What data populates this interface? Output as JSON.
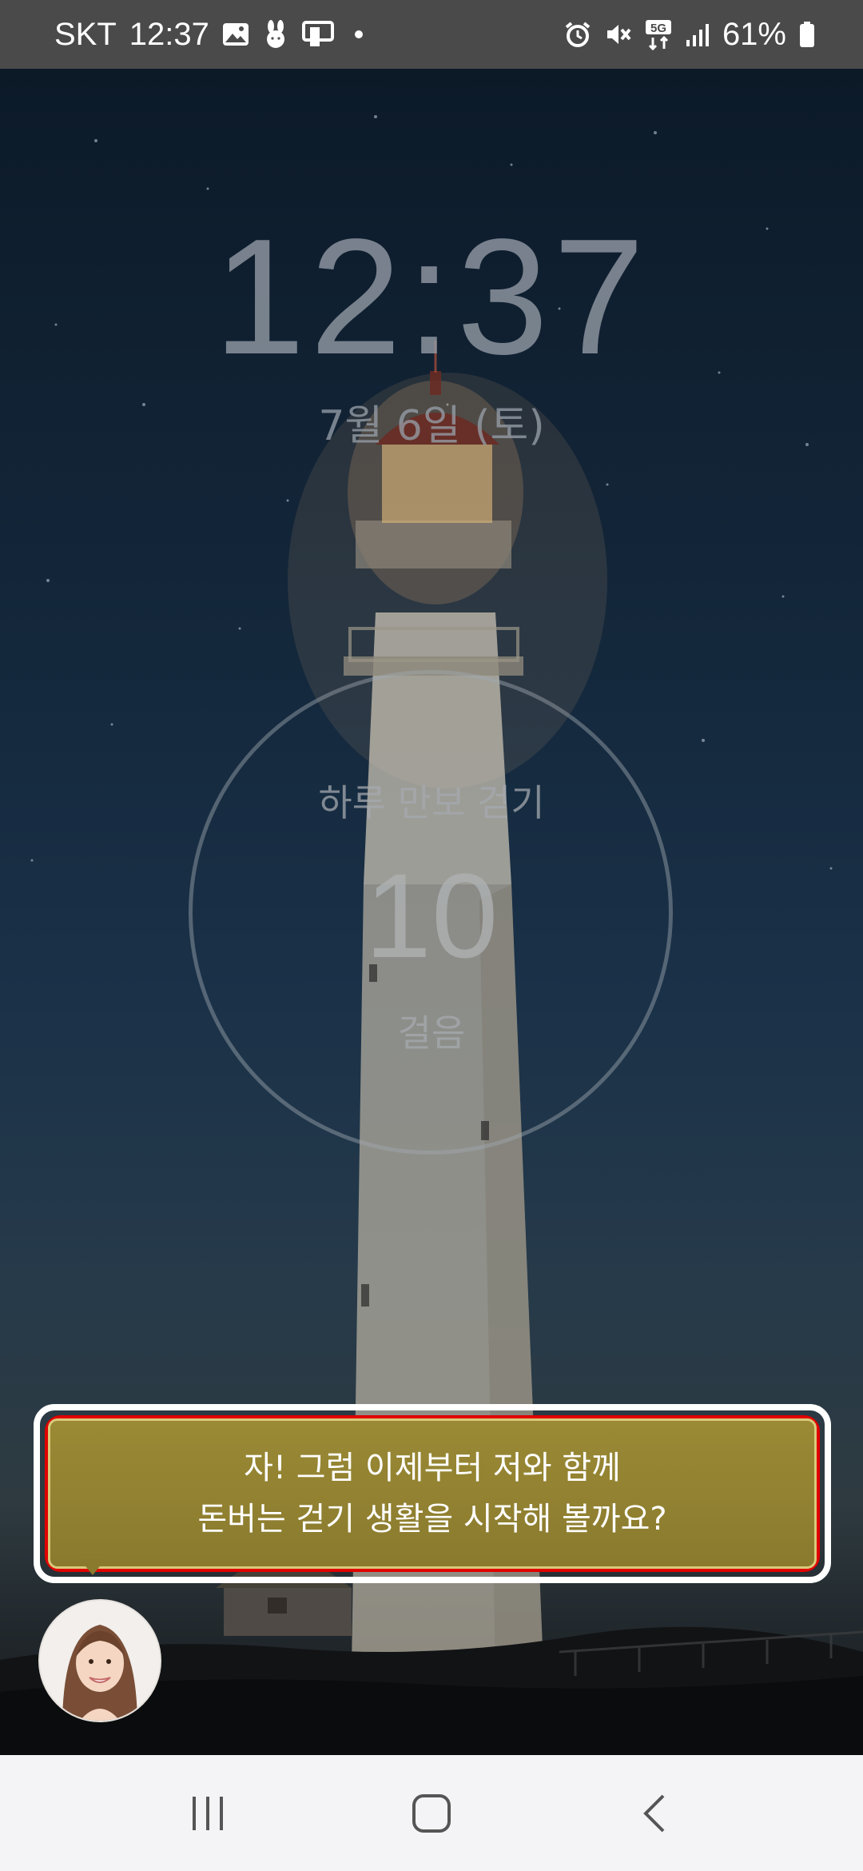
{
  "status_bar": {
    "carrier": "SKT",
    "time": "12:37",
    "network": "5G",
    "battery": "61%",
    "left_icons": [
      "gallery-icon",
      "rabbit-app-icon",
      "cast-icon",
      "dot-icon"
    ],
    "right_icons": [
      "alarm-icon",
      "mute-icon",
      "5g-icon",
      "signal-icon",
      "battery-icon"
    ]
  },
  "lock_screen": {
    "time": "12:37",
    "date": "7월 6일 (토)"
  },
  "step_widget": {
    "title": "하루 만보 걷기",
    "count": "10",
    "unit": "걸음"
  },
  "speech_bubble": {
    "line1": "자! 그럼 이제부터 저와 함께",
    "line2": "돈버는 걷기 생활을 시작해 볼까요?",
    "highlight_color": "#e00000",
    "fill_color": "#8a7a2e"
  },
  "nav_bar": {
    "buttons": [
      "recent-apps-icon",
      "home-icon",
      "back-icon"
    ]
  }
}
